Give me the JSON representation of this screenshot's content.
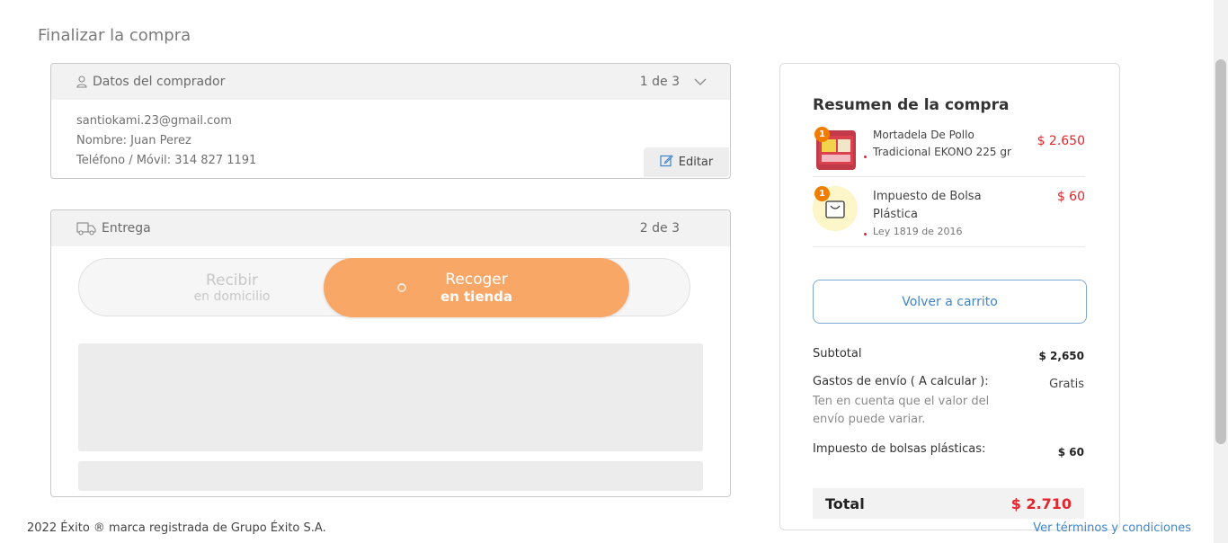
{
  "page": {
    "title": "Finalizar la compra"
  },
  "buyer": {
    "title": "Datos del comprador",
    "step": "1 de 3",
    "email": "santiokami.23@gmail.com",
    "name": "Nombre: Juan Perez",
    "phone": "Teléfono / Móvil: 314 827 1191",
    "edit_label": "Editar"
  },
  "delivery": {
    "title": "Entrega",
    "step": "2 de 3",
    "options": [
      {
        "line1": "Recibir",
        "line2": "en domicilio",
        "selected": false
      },
      {
        "line1": "Recoger",
        "line2": "en tienda",
        "selected": true
      }
    ]
  },
  "summary": {
    "title": "Resumen de la compra",
    "items": [
      {
        "qty": "1",
        "name_line1": "Mortadela De Pollo",
        "name_line2": "Tradicional EKONO 225 gr",
        "price": "$ 2.650",
        "icon": "mortadela-product-image"
      },
      {
        "qty": "1",
        "name_line1": "Impuesto de Bolsa",
        "name_line2": "Plástica",
        "sub": "Ley 1819 de 2016",
        "price": "$ 60",
        "icon": "shopping-bag-icon"
      }
    ],
    "back_button": "Volver a carrito",
    "subtotal_label": "Subtotal",
    "subtotal_value": "$ 2,650",
    "shipping_label": "Gastos de envío ( A calcular ):",
    "shipping_value": "Gratis",
    "shipping_note": "Ten en cuenta que el valor del envío puede variar.",
    "bags_label": "Impuesto de bolsas plásticas:",
    "bags_value": "$ 60",
    "total_label": "Total",
    "total_value": "$ 2.710"
  },
  "footer": {
    "copyright": "2022 Éxito ® marca registrada de Grupo Éxito S.A.",
    "terms_link": "Ver términos y condiciones"
  },
  "colors": {
    "accent_orange": "#f8a767",
    "price_red": "#e3262e",
    "link_blue": "#3f85c9",
    "badge_orange": "#f07c00"
  }
}
